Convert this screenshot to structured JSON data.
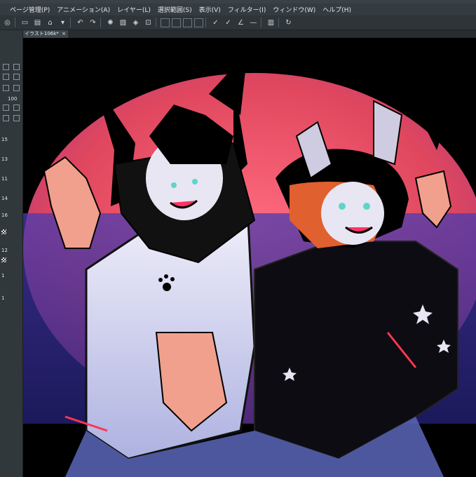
{
  "menubar": {
    "items": [
      "ページ管理(P)",
      "アニメーション(A)",
      "レイヤー(L)",
      "選択範囲(S)",
      "表示(V)",
      "フィルター(I)",
      "ウィンドウ(W)",
      "ヘルプ(H)"
    ]
  },
  "toolbar": {
    "icons": [
      "app-icon",
      "new-file-icon",
      "save-icon",
      "print-icon",
      "undo-icon",
      "redo-icon",
      "loading-icon",
      "clear-icon",
      "fill-icon",
      "transform-icon",
      "cut-icon",
      "select-all-icon",
      "deselect-icon",
      "pen-icon",
      "pencil-icon",
      "ruler-icon",
      "layer-icon",
      "refresh-icon"
    ]
  },
  "tab": {
    "title": "イラスト106k*",
    "close": "×"
  },
  "left_panel": {
    "zoom_value": "100",
    "rows": [
      {
        "label": "15"
      },
      {
        "label": "13"
      },
      {
        "label": "11"
      },
      {
        "label": "14"
      },
      {
        "label": "16"
      },
      {
        "label": "12"
      },
      {
        "label": "1"
      },
      {
        "label": "1"
      }
    ]
  },
  "colors": {
    "background": "#000000",
    "moon": "#e0475e",
    "sky": "#3b3ba8",
    "panel": "#30383c",
    "menubar": "#343c41"
  }
}
